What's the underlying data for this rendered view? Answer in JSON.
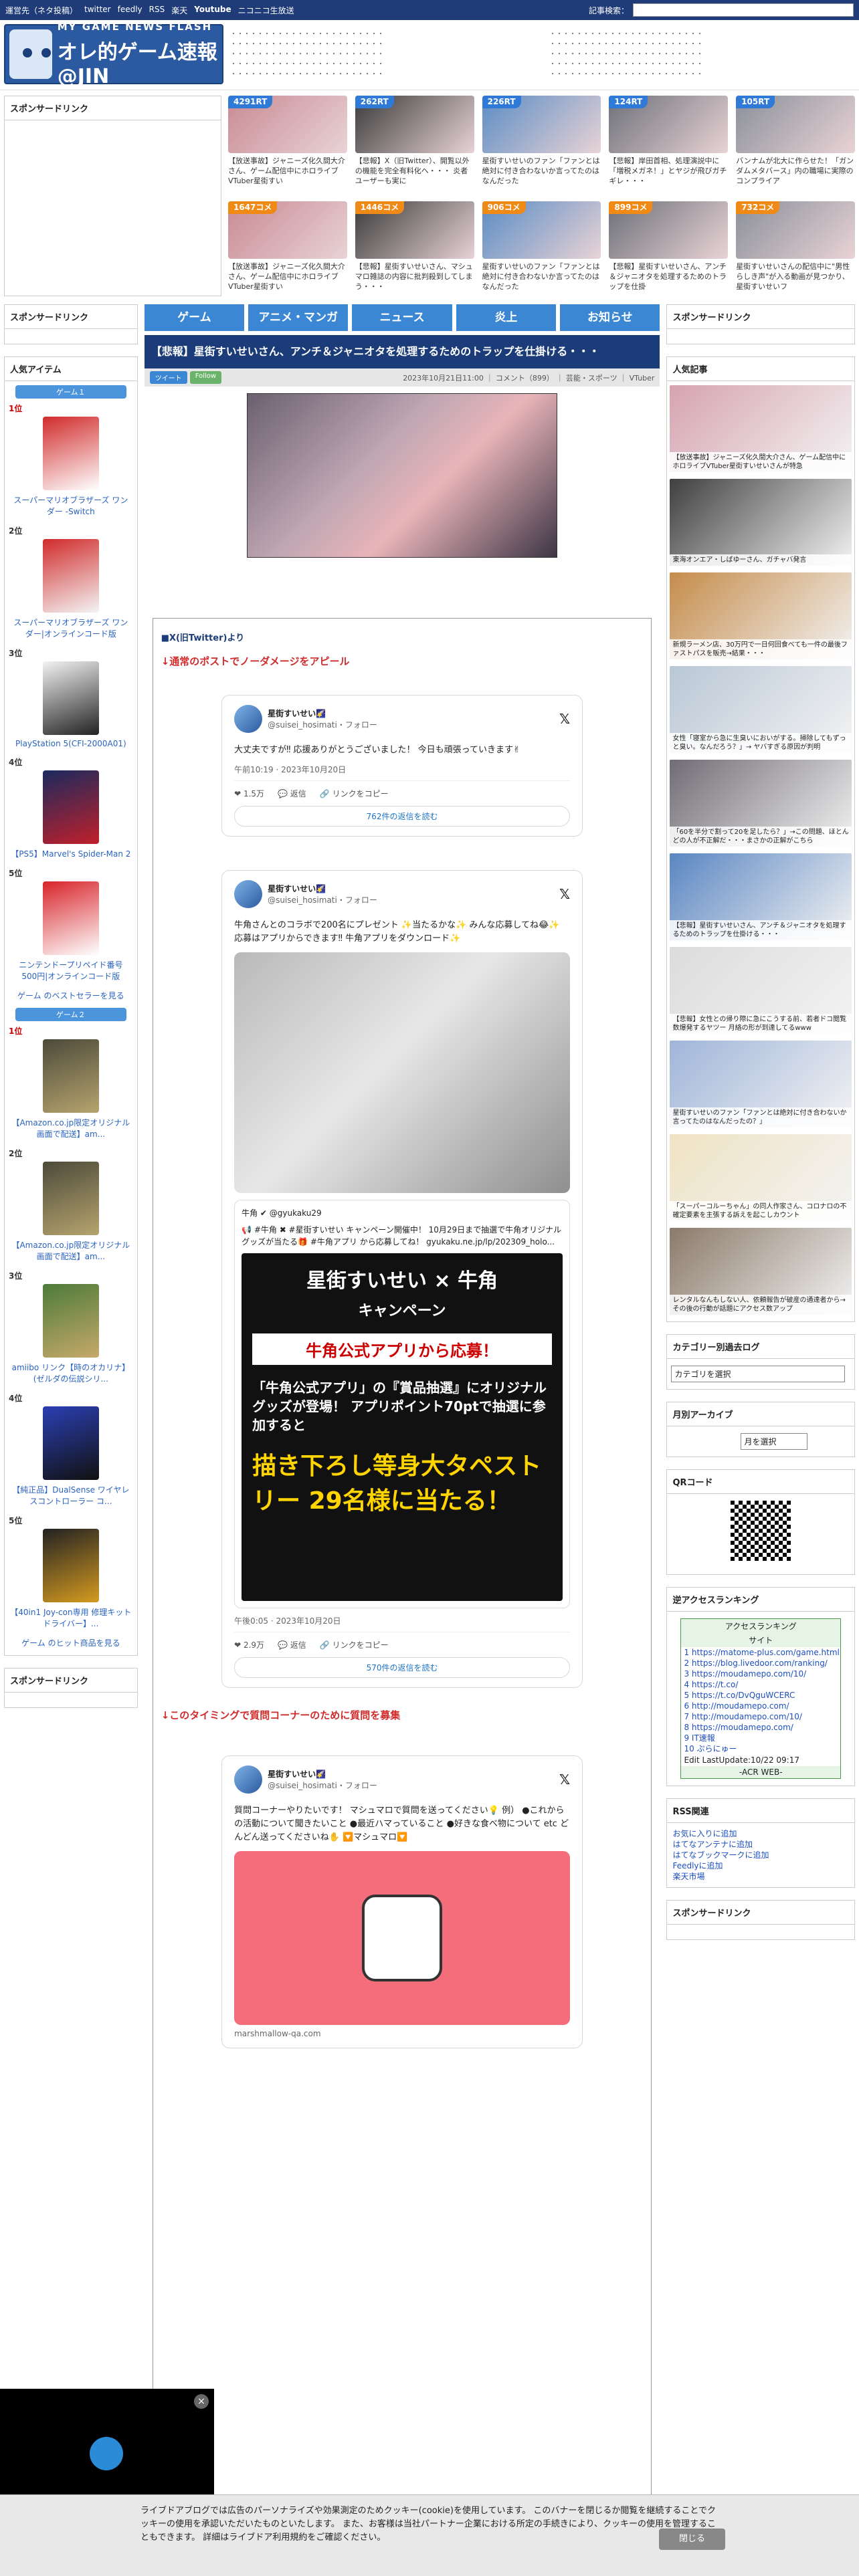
{
  "topbar": {
    "links": [
      "運営先（ネタ投稿）",
      "twitter",
      "feedly",
      "RSS",
      "楽天",
      "Youtube",
      "ニコニコ生放送"
    ],
    "search_label": "記事検索："
  },
  "logo": {
    "line1": "MY GAME NEWS FLASH",
    "line2": "オレ的ゲーム速報@JIN"
  },
  "top_sponsor": "スポンサードリンク",
  "cards": [
    {
      "badge": "4291RT",
      "color": "blue",
      "text": "【放送事故】ジャニーズ化久間大介さん、ゲーム配信中にホロライブVTuber星街すい"
    },
    {
      "badge": "262RT",
      "color": "blue",
      "text": "【悲報】X（旧Twitter）、開覧以外の機能を完全有料化へ・・・ 炎者ユーザーも実に"
    },
    {
      "badge": "226RT",
      "color": "blue",
      "text": "星街すいせいのファン「ファンとは絶対に付き合わないか言ってたのはなんだった"
    },
    {
      "badge": "124RT",
      "color": "blue",
      "text": "【悲報】岸田首相、処理演説中に「増税メガネ！」とヤジが飛びガチギレ・・・"
    },
    {
      "badge": "105RT",
      "color": "blue",
      "text": "バンナムが北大に作らせた！「ガンダムメタバース」内の職場に実際のコンプライア"
    },
    {
      "badge": "1647コメ",
      "color": "orange",
      "text": "【放送事故】ジャニーズ化久間大介さん、ゲーム配信中にホロライブVTuber星街すい"
    },
    {
      "badge": "1446コメ",
      "color": "orange",
      "text": "【悲報】星街すいせいさん、マシュマロ雑誌の内容に批判殺到してしまう・・・"
    },
    {
      "badge": "906コメ",
      "color": "orange",
      "text": "星街すいせいのファン「ファンとは絶対に付き合わないか言ってたのはなんだった"
    },
    {
      "badge": "899コメ",
      "color": "orange",
      "text": "【悲報】星街すいせいさん、アンチ＆ジャニオタを処理するためのトラップを仕掛"
    },
    {
      "badge": "732コメ",
      "color": "orange",
      "text": "星街すいせいさんの配信中に\"男性らしき声\"が入る動画が見つかり、星街すいせいフ"
    }
  ],
  "nav": [
    "ゲーム",
    "アニメ・マンガ",
    "ニュース",
    "炎上",
    "お知らせ"
  ],
  "left": {
    "sponsor": "スポンサードリンク",
    "popular": "人気アイテム",
    "game1": "ゲーム１",
    "game2": "ゲーム２",
    "list1": [
      {
        "rank": "1位",
        "name": "スーパーマリオブラザーズ ワンダー -Switch"
      },
      {
        "rank": "2位",
        "name": "スーパーマリオブラザーズ ワンダー|オンラインコード版"
      },
      {
        "rank": "3位",
        "name": "PlayStation 5(CFI-2000A01)"
      },
      {
        "rank": "4位",
        "name": "【PS5】Marvel's Spider-Man 2"
      },
      {
        "rank": "5位",
        "name": "ニンテンドープリペイド番号 500円|オンラインコード版"
      }
    ],
    "more1": "ゲーム のベストセラーを見る",
    "list2": [
      {
        "rank": "1位",
        "name": "【Amazon.co.jp限定オリジナル画面で配送】am..."
      },
      {
        "rank": "2位",
        "name": "【Amazon.co.jp限定オリジナル画面で配送】am..."
      },
      {
        "rank": "3位",
        "name": "amiibo リンク【時のオカリナ】(ゼルダの伝説シリ..."
      },
      {
        "rank": "4位",
        "name": "【純正品】DualSense ワイヤレスコントローラー コ..."
      },
      {
        "rank": "5位",
        "name": "【40in1 Joy-con専用 修理キットドライバー】..."
      }
    ],
    "more2": "ゲーム のヒット商品を見る",
    "sponsor2": "スポンサードリンク"
  },
  "article": {
    "title": "【悲報】星街すいせいさん、アンチ＆ジャニオタを処理するためのトラップを仕掛ける・・・",
    "share": "ツイート",
    "follow": "Follow",
    "meta": "2023年10月21日11:00 ｜ コメント（899） ｜ 芸能・スポーツ ｜ VTuber",
    "source": "■X(旧Twitter)より",
    "note1": "↓通常のポストでノーダメージをアピール",
    "note2": "↓このタイミングで質問コーナーのために質問を募集",
    "tweets": [
      {
        "name": "星街すいせい🌠",
        "handle": "@suisei_hosimati・フォロー",
        "text": "大丈夫ですが‼ 応援ありがとうございました！ 今日も頑張っていきます✌",
        "time": "午前10:19 · 2023年10月20日",
        "likes": "1.5万",
        "replies": "返信",
        "share": "リンクをコピー",
        "link": "762件の返信を読む"
      },
      {
        "name": "星街すいせい🌠",
        "handle": "@suisei_hosimati・フォロー",
        "text": "牛角さんとのコラボで200名にプレゼント ✨当たるかな✨ みんな応募してね😂✨ 応募はアプリからできます‼ 牛角アプリをダウンロード✨",
        "quote_name": "牛角 ✔ @gyukaku29",
        "quote_text": "📢 #牛角 ✖ #星街すいせい キャンペーン開催中！ 10月29日まで抽選で牛角オリジナルグッズが当たる🎁 #牛角アプリ から応募してね！ gyukaku.ne.jp/lp/202309_holo...",
        "campaign_title": "星街すいせい × 牛角",
        "campaign_sub": "キャンペーン",
        "campaign_apply": "牛角公式アプリから応募！",
        "campaign_body": "「牛角公式アプリ」の『賞品抽選』にオリジナルグッズが登場！ アプリポイント70ptで抽選に参加すると",
        "campaign_prize": "描き下ろし等身大タペストリー 29名様に当たる！",
        "time": "午後0:05 · 2023年10月20日",
        "likes": "2.9万",
        "replies": "返信",
        "share": "リンクをコピー",
        "link": "570件の返信を読む"
      },
      {
        "name": "星街すいせい🌠",
        "handle": "@suisei_hosimati・フォロー",
        "text": "質問コーナーやりたいです！ マシュマロで質問を送ってください💡 例） ●これからの活動について聞きたいこと ●最近ハマっていること ●好きな食べ物について etc どんどん送ってくださいね✋ 🔽マシュマロ🔽",
        "footer": "marshmallow-qa.com"
      }
    ]
  },
  "right": {
    "sponsor": "スポンサードリンク",
    "popular": "人気記事",
    "popular_items": [
      "【放送事故】ジャニーズ化久間大介さん、ゲーム配信中にホロライブVTuber星街すいせいさんが特急",
      "東海オンエア・しばゆーさん、ガチャバ発言",
      "新規ラーメン店、30万円で一日何回食べても一件の最後ファストパスを販売→結果・・・",
      "女性「寝室から急に生臭いにおいがする。掃除してもずっと臭い。なんだろう？」→ ヤバすぎる原因が判明",
      "「60を半分で割って20を足したら？」→この問題、ほとんどの人が不正解だ・・・まさかの正解がこちら",
      "【悲報】星街すいせいさん、アンチ＆ジャニオタを処理するためのトラップを仕掛ける・・・",
      "【悲報】女性との帰り際に急にこうする前、若者ドコ閲覧数爆発するヤツー 月絡の形が到達してるwww",
      "星街すいせいのファン「ファンとは絶対に付き合わないか言ってたのはなんだったの？」",
      "「スーパーコルーちゃん」の同人作家さん、コロナロの不確定要素を主張する訴えを起こしカウント",
      "レンタルなんもしない人、依頼報告が破産の通達者から→その後の行動が話題にアクセス数アップ"
    ],
    "category_head": "カテゴリー別過去ログ",
    "category_select": "カテゴリを選択",
    "month_head": "月別アーカイブ",
    "month_select": "月を選択",
    "qr_head": "QRコード",
    "acr_head": "逆アクセスランキング",
    "acr_title": "アクセスランキング",
    "acr_sub": "サイト",
    "acr_items": [
      "1 https://matome-plus.com/game.html",
      "2 https://blog.livedoor.com/ranking/",
      "3 https://moudamepo.com/10/",
      "4 https://t.co/",
      "5 https://t.co/DvQguWCERC",
      "6 http://moudamepo.com/",
      "7 http://moudamepo.com/10/",
      "8 https://moudamepo.com/",
      "9 IT速報",
      "10 ぷらにゅー"
    ],
    "acr_update": "Edit LastUpdate:10/22 09:17",
    "acr_footer": "-ACR WEB-",
    "rss_head": "RSS関連",
    "rss_items": [
      "お気に入りに追加",
      "はてなアンテナに追加",
      "はてなブックマークに追加",
      "Feedlyに追加",
      "楽天市場"
    ],
    "sponsor2": "スポンサードリンク"
  },
  "cookie": {
    "text": "ライブドアブログでは広告のパーソナライズや効果測定のためクッキー(cookie)を使用しています。 このバナーを閉じるか閲覧を継続することでクッキーの使用を承認いただいたものといたします。 また、お客様は当社パートナー企業における所定の手続きにより、クッキーの使用を管理することもできます。 詳細はライブドア利用規約をご確認ください。",
    "close": "閉じる"
  }
}
